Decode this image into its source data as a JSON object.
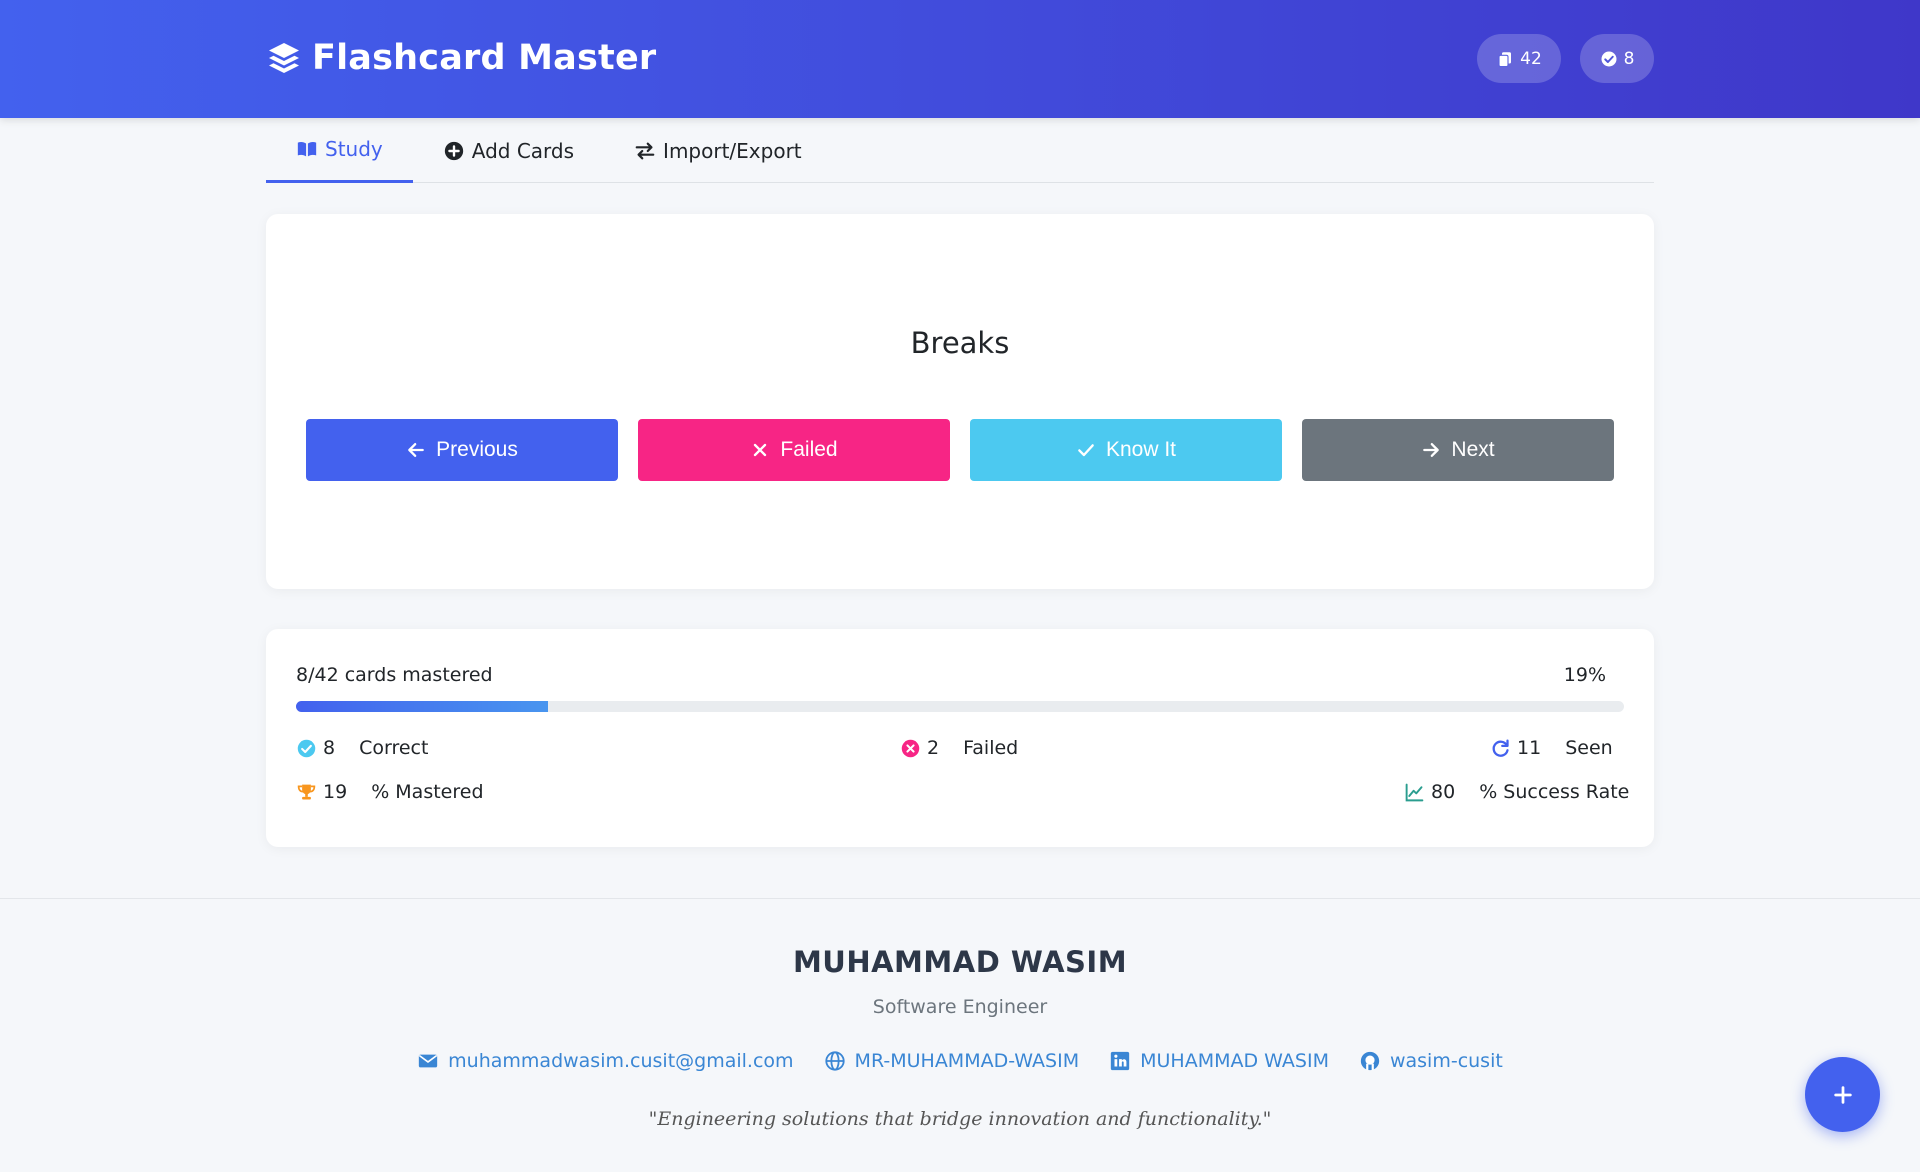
{
  "header": {
    "title": "Flashcard Master",
    "total_cards": "42",
    "mastered_count": "8"
  },
  "tabs": [
    {
      "label": "Study",
      "icon": "book-open-icon",
      "active": true
    },
    {
      "label": "Add Cards",
      "icon": "plus-circle-icon",
      "active": false
    },
    {
      "label": "Import/Export",
      "icon": "exchange-icon",
      "active": false
    }
  ],
  "card": {
    "term": "Breaks",
    "buttons": {
      "previous": "Previous",
      "failed": "Failed",
      "know": "Know It",
      "next": "Next"
    }
  },
  "progress": {
    "label": "8/42 cards mastered",
    "percent_text": "19%",
    "fraction": 0.19,
    "stats": {
      "correct_value": "8",
      "correct_label": "Correct",
      "failed_value": "2",
      "failed_label": "Failed",
      "seen_value": "11",
      "seen_label": "Seen",
      "mastered_value": "19",
      "mastered_label": "% Mastered",
      "rate_value": "80",
      "rate_label": "% Success Rate"
    }
  },
  "footer": {
    "name": "MUHAMMAD WASIM",
    "role": "Software Engineer",
    "links": {
      "email": "muhammadwasim.cusit@gmail.com",
      "website": "MR-MUHAMMAD-WASIM",
      "linkedin": "MUHAMMAD WASIM",
      "github": "wasim-cusit"
    },
    "quote": "\"Engineering solutions that bridge innovation and functionality.\""
  },
  "colors": {
    "primary": "#4361ee",
    "danger": "#f72585",
    "success": "#4cc9f0",
    "secondary": "#6c757d"
  }
}
